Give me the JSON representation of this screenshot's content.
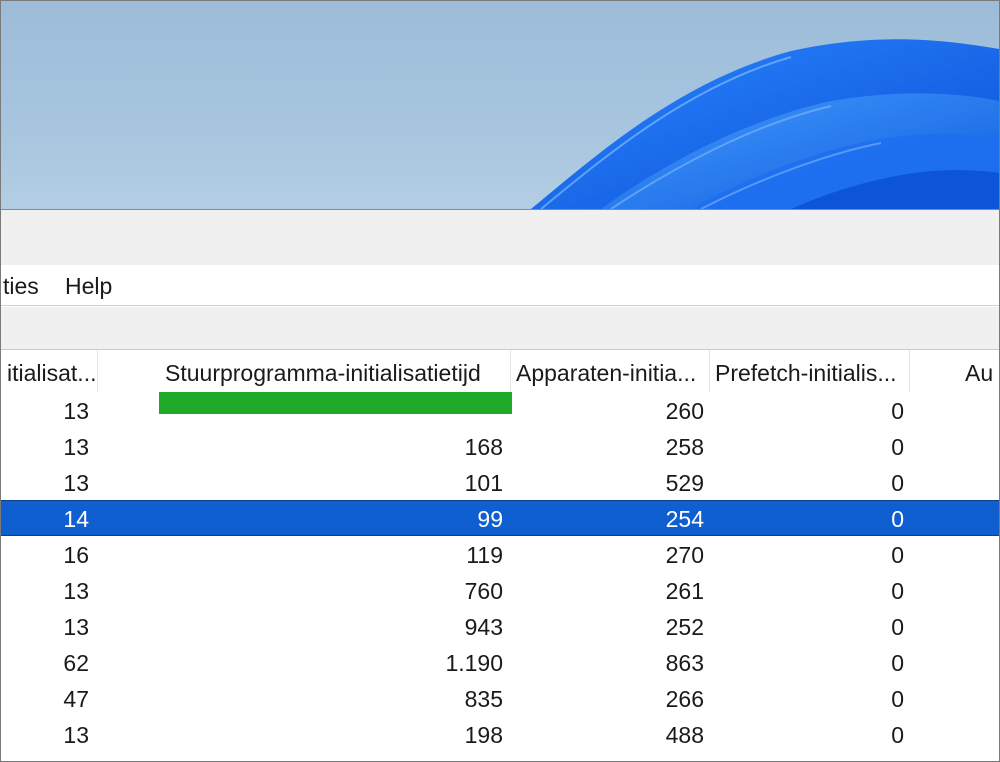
{
  "menu": {
    "items": [
      "ties",
      "Help"
    ]
  },
  "table": {
    "columns": [
      "itialisat...",
      "Stuurprogramma-initialisatietijd",
      "Apparaten-initia...",
      "Prefetch-initialis...",
      "Au"
    ],
    "selected_row_index": 3,
    "rows": [
      [
        "13",
        "",
        "260",
        "0"
      ],
      [
        "13",
        "168",
        "258",
        "0"
      ],
      [
        "13",
        "101",
        "529",
        "0"
      ],
      [
        "14",
        "99",
        "254",
        "0"
      ],
      [
        "16",
        "119",
        "270",
        "0"
      ],
      [
        "13",
        "760",
        "261",
        "0"
      ],
      [
        "13",
        "943",
        "252",
        "0"
      ],
      [
        "62",
        "1.190",
        "863",
        "0"
      ],
      [
        "47",
        "835",
        "266",
        "0"
      ],
      [
        "13",
        "198",
        "488",
        "0"
      ]
    ]
  },
  "colors": {
    "selection": "#0f5fd0",
    "highlight_marker": "#1faa2a",
    "wallpaper_bloom": "#1f6fe0"
  }
}
